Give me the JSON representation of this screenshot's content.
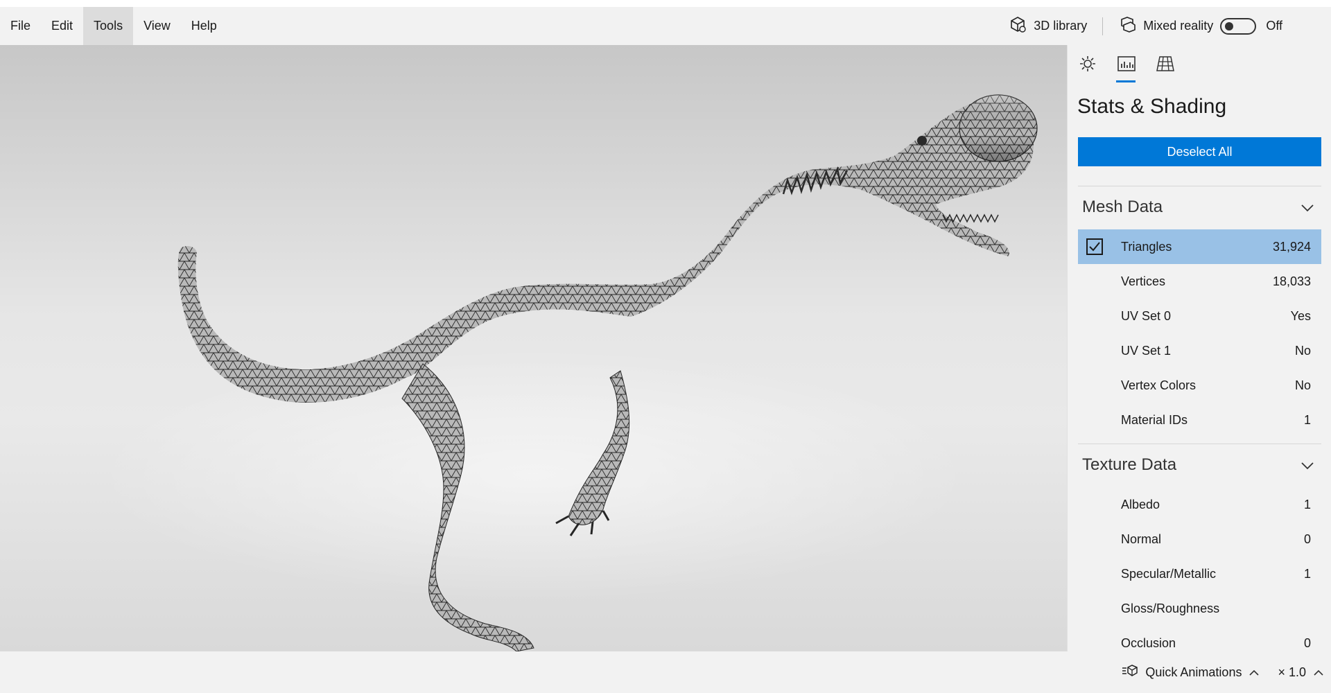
{
  "menu": {
    "items": [
      "File",
      "Edit",
      "Tools",
      "View",
      "Help"
    ],
    "active": "Tools"
  },
  "toolbar": {
    "library_label": "3D library",
    "mixed_reality_label": "Mixed reality",
    "mixed_reality_state": "Off",
    "library_icon": "cube-library-icon",
    "mixed_reality_icon": "mixed-reality-icon"
  },
  "panel": {
    "tabs": [
      {
        "name": "lighting",
        "icon": "sun-icon"
      },
      {
        "name": "stats",
        "icon": "stats-chart-icon",
        "active": true
      },
      {
        "name": "grid",
        "icon": "grid-icon"
      }
    ],
    "title": "Stats & Shading",
    "deselect_label": "Deselect All",
    "mesh_section": {
      "title": "Mesh Data",
      "rows": [
        {
          "label": "Triangles",
          "value": "31,924",
          "checked": true
        },
        {
          "label": "Vertices",
          "value": "18,033"
        },
        {
          "label": "UV Set 0",
          "value": "Yes"
        },
        {
          "label": "UV Set 1",
          "value": "No"
        },
        {
          "label": "Vertex Colors",
          "value": "No"
        },
        {
          "label": "Material IDs",
          "value": "1"
        }
      ]
    },
    "texture_section": {
      "title": "Texture Data",
      "rows": [
        {
          "label": "Albedo",
          "value": "1"
        },
        {
          "label": "Normal",
          "value": "0"
        },
        {
          "label": "Specular/Metallic",
          "value": "1"
        },
        {
          "label": "Gloss/Roughness",
          "value": ""
        },
        {
          "label": "Occlusion",
          "value": "0"
        }
      ]
    }
  },
  "bottom": {
    "animations_label": "Quick Animations",
    "speed_label": "× 1.0"
  },
  "colors": {
    "accent": "#0078d7",
    "selected_row": "#99c1e6",
    "chrome": "#f2f2f2"
  }
}
